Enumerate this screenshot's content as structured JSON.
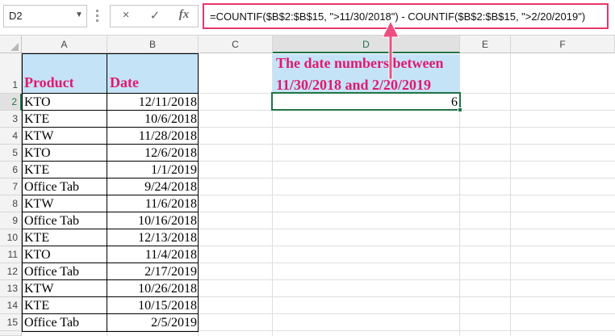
{
  "formula_bar": {
    "name_box": "D2",
    "cancel_icon": "×",
    "enter_icon": "✓",
    "fx_label": "fx",
    "formula": "=COUNTIF($B$2:$B$15, \">11/30/2018\") - COUNTIF($B$2:$B$15, \">2/20/2019\")"
  },
  "columns": [
    "A",
    "B",
    "C",
    "D",
    "E",
    "F"
  ],
  "selected_column": "D",
  "selected_row": "2",
  "header_row": {
    "product": "Product",
    "date": "Date"
  },
  "rows": [
    {
      "num": "1"
    },
    {
      "num": "2",
      "product": "KTO",
      "date": "12/11/2018"
    },
    {
      "num": "3",
      "product": "KTE",
      "date": "10/6/2018"
    },
    {
      "num": "4",
      "product": "KTW",
      "date": "11/28/2018"
    },
    {
      "num": "5",
      "product": "KTO",
      "date": "12/6/2018"
    },
    {
      "num": "6",
      "product": "KTE",
      "date": "1/1/2019"
    },
    {
      "num": "7",
      "product": "Office Tab",
      "date": "9/24/2018"
    },
    {
      "num": "8",
      "product": "KTW",
      "date": "11/6/2018"
    },
    {
      "num": "9",
      "product": "Office Tab",
      "date": "10/16/2018"
    },
    {
      "num": "10",
      "product": "KTE",
      "date": "12/13/2018"
    },
    {
      "num": "11",
      "product": "KTO",
      "date": "11/4/2018"
    },
    {
      "num": "12",
      "product": "Office Tab",
      "date": "2/17/2019"
    },
    {
      "num": "13",
      "product": "KTW",
      "date": "10/26/2018"
    },
    {
      "num": "14",
      "product": "KTE",
      "date": "10/15/2018"
    },
    {
      "num": "15",
      "product": "Office Tab",
      "date": "2/5/2019"
    }
  ],
  "d1": {
    "line1": "The date numbers between",
    "line2": "11/30/2018 and 2/20/2019"
  },
  "d2": {
    "value": "6"
  },
  "colors": {
    "header_fill": "#c5e3f7",
    "header_text": "#e0196e",
    "formula_border": "#e8366b",
    "arrow": "#ee4e7f",
    "selection": "#217346"
  }
}
